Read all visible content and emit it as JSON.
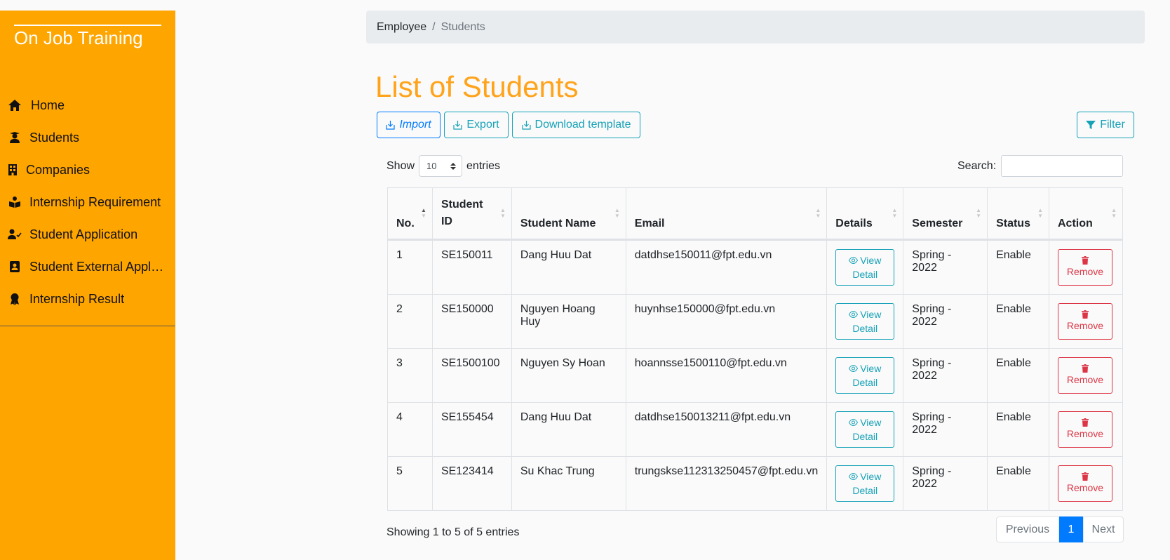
{
  "sidebar": {
    "brand": "On Job Training",
    "items": [
      {
        "label": "Home",
        "icon": "home-icon"
      },
      {
        "label": "Students",
        "icon": "user-graduate-icon"
      },
      {
        "label": "Companies",
        "icon": "building-icon"
      },
      {
        "label": "Internship Requirement",
        "icon": "book-reader-icon"
      },
      {
        "label": "Student Application",
        "icon": "user-check-icon"
      },
      {
        "label": "Student External Application",
        "icon": "id-badge-icon"
      },
      {
        "label": "Internship Result",
        "icon": "award-icon"
      }
    ]
  },
  "breadcrumb": {
    "parent": "Employee",
    "separator": "/",
    "current": "Students"
  },
  "page": {
    "title": "List of Students"
  },
  "toolbar": {
    "import_label": "Import",
    "export_label": "Export",
    "template_label": "Download template",
    "filter_label": "Filter"
  },
  "table_controls": {
    "show_label": "Show",
    "entries_value": "10",
    "entries_label": "entries",
    "search_label": "Search:",
    "search_value": ""
  },
  "table": {
    "headers": {
      "no": "No.",
      "student_id": "Student ID",
      "student_name": "Student Name",
      "email": "Email",
      "details": "Details",
      "semester": "Semester",
      "status": "Status",
      "action": "Action"
    },
    "view_line1": "View",
    "view_line2": "Detail",
    "remove_label": "Remove",
    "rows": [
      {
        "no": "1",
        "id": "SE150011",
        "name": "Dang Huu Dat",
        "email": "datdhse150011@fpt.edu.vn",
        "semester": "Spring - 2022",
        "status": "Enable"
      },
      {
        "no": "2",
        "id": "SE150000",
        "name": "Nguyen Hoang Huy",
        "email": "huynhse150000@fpt.edu.vn",
        "semester": "Spring - 2022",
        "status": "Enable"
      },
      {
        "no": "3",
        "id": "SE1500100",
        "name": "Nguyen Sy Hoan",
        "email": "hoannsse1500110@fpt.edu.vn",
        "semester": "Spring - 2022",
        "status": "Enable"
      },
      {
        "no": "4",
        "id": "SE155454",
        "name": "Dang Huu Dat",
        "email": "datdhse150013211@fpt.edu.vn",
        "semester": "Spring - 2022",
        "status": "Enable"
      },
      {
        "no": "5",
        "id": "SE123414",
        "name": "Su Khac Trung",
        "email": "trungskse112313250457@fpt.edu.vn",
        "semester": "Spring - 2022",
        "status": "Enable"
      }
    ]
  },
  "footer": {
    "info": "Showing 1 to 5 of 5 entries",
    "previous": "Previous",
    "current_page": "1",
    "next": "Next"
  },
  "colors": {
    "sidebar": "#ffa500",
    "title": "#ffa31a",
    "info": "#17a2b8",
    "primary": "#007bff",
    "danger": "#dc3545"
  }
}
